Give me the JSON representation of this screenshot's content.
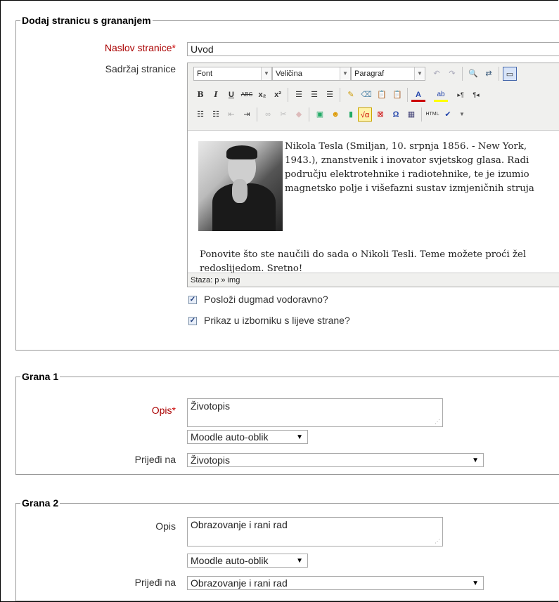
{
  "add_page": {
    "legend": "Dodaj stranicu s grananjem",
    "title_label": "Naslov stranice",
    "title_value": "Uvod",
    "content_label": "Sadržaj stranice",
    "required_mark": "*",
    "editor": {
      "font_select": "Font",
      "size_select": "Veličina",
      "format_select": "Paragraf",
      "path_text": "Staza: p » img",
      "paragraph1_line1": "Nikola Tesla (Smiljan, 10. srpnja 1856. - New York,",
      "paragraph1_line2": "1943.), znanstvenik i inovator svjetskog glasa. Radi",
      "paragraph1_line3": "području elektrotehnike i radiotehnike, te je izumio",
      "paragraph1_line4": "magnetsko polje i višefazni sustav izmjeničnih struja",
      "paragraph2_line1": "Ponovite što ste naučili do sada o Nikoli Tesli. Teme možete proći žel",
      "paragraph2_line2": "redoslijedom. Sretno!"
    },
    "checkbox1_label": "Posloži dugmad vodoravno?",
    "checkbox2_label": "Prikaz u izborniku s lijeve strane?"
  },
  "branch1": {
    "legend": "Grana 1",
    "desc_label": "Opis",
    "desc_value": "Životopis",
    "format_value": "Moodle auto-oblik",
    "goto_label": "Prijeđi na",
    "goto_value": "Životopis"
  },
  "branch2": {
    "legend": "Grana 2",
    "desc_label": "Opis",
    "desc_value": "Obrazovanje i rani rad",
    "format_value": "Moodle auto-oblik",
    "goto_label": "Prijeđi na",
    "goto_value": "Obrazovanje i rani rad"
  }
}
